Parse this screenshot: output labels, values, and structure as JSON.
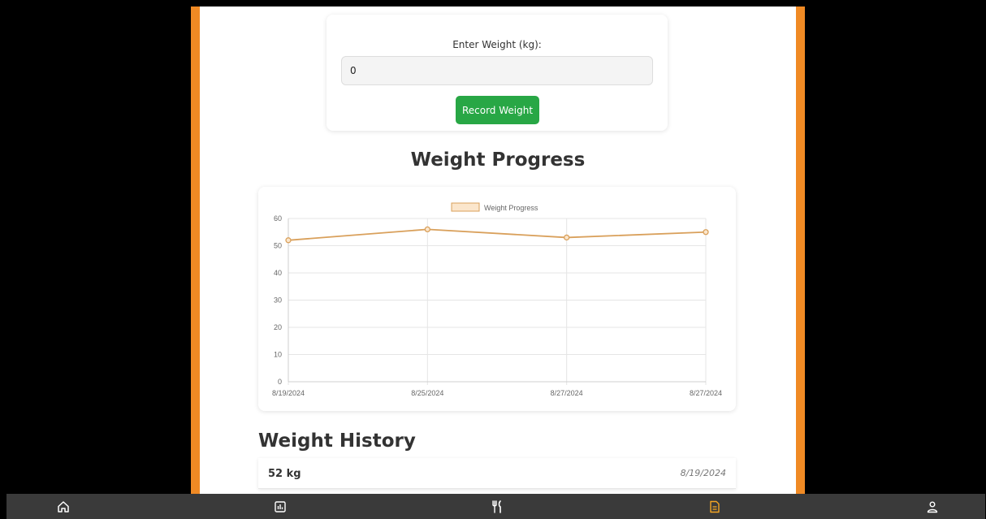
{
  "weight_form": {
    "label": "Enter Weight (kg):",
    "input_value": "0",
    "button_label": "Record Weight"
  },
  "progress": {
    "title": "Weight Progress"
  },
  "chart_data": {
    "type": "line",
    "categories": [
      "8/19/2024",
      "8/25/2024",
      "8/27/2024",
      "8/27/2024"
    ],
    "series": [
      {
        "name": "Weight Progress",
        "values": [
          52,
          56,
          53,
          55
        ],
        "color": "#d9a05b"
      }
    ],
    "ylim": [
      0,
      60
    ],
    "yticks": [
      0,
      10,
      20,
      30,
      40,
      50,
      60
    ],
    "grid": true,
    "legend": "top-center"
  },
  "history": {
    "title": "Weight History",
    "entries": [
      {
        "weight": "52 kg",
        "date": "8/19/2024"
      }
    ]
  },
  "nav": {
    "items": [
      {
        "icon": "home-icon"
      },
      {
        "icon": "chart-icon"
      },
      {
        "icon": "utensils-icon"
      },
      {
        "icon": "document-icon",
        "active": true
      },
      {
        "icon": "user-icon"
      }
    ],
    "active_color": "#f5a623",
    "inactive_color": "#ffffff"
  }
}
